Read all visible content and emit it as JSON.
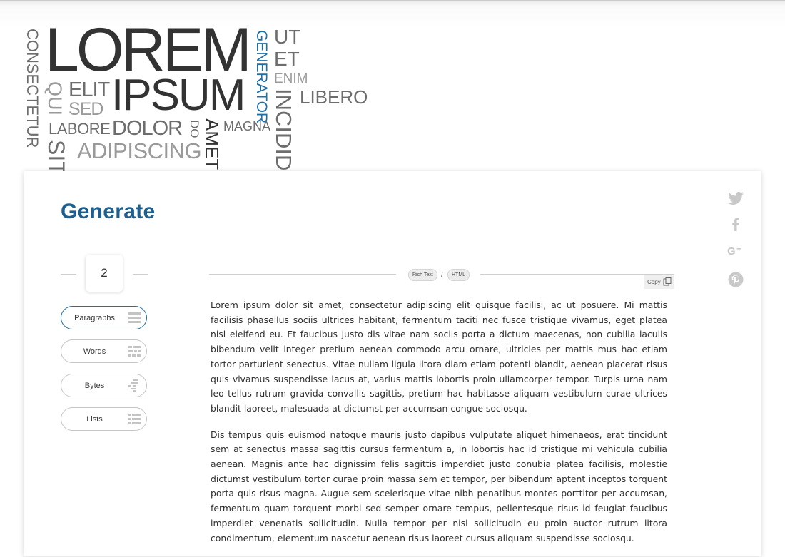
{
  "word_cloud": {
    "consectetur": "CONSECTETUR",
    "lorem": "LOREM",
    "ipsum": "IPSUM",
    "qui": "QUI",
    "elit": "ELIT",
    "sed": "SED",
    "labore": "LABORE",
    "dolor": "DOLOR",
    "do": "DO",
    "amet": "AMET",
    "sit": "SIT",
    "adipiscing": "ADIPISCING",
    "generator": "GENERATOR",
    "magna": "MAGNA",
    "ut": "UT",
    "et": "ET",
    "enim": "ENIM",
    "libero": "LIBERO",
    "incidid": "INCIDID"
  },
  "generator": {
    "title": "Generate",
    "count": "2",
    "modes": {
      "paragraphs": "Paragraphs",
      "words": "Words",
      "bytes": "Bytes",
      "lists": "Lists"
    },
    "active_mode": "Paragraphs",
    "format_tabs": {
      "rich_text": "Rich Text",
      "separator": "/",
      "html": "HTML"
    },
    "copy_label": "Copy",
    "paragraphs": [
      "Lorem ipsum dolor sit amet, consectetur adipiscing elit quisque facilisi, ac ut posuere. Mi mattis facilisis phasellus sociis ultrices habitant, fermentum taciti nec fusce tristique vivamus, eget platea nisl eleifend eu. Et faucibus justo dis vitae nam sociis porta a dictum maecenas, non cubilia iaculis bibendum velit integer pretium aenean commodo arcu ornare, ultricies per mattis mus hac etiam tortor parturient senectus. Vitae nullam ligula litora diam etiam potenti blandit, aenean placerat risus quis vivamus suspendisse lacus at, varius mattis lobortis proin ullamcorper tempor. Turpis urna nam leo tellus rutrum gravida convallis sagittis, pretium hac habitasse aliquam vestibulum curae ultrices blandit laoreet, malesuada at dictumst per accumsan congue sociosqu.",
      "Dis tempus quis euismod natoque mauris justo dapibus vulputate aliquet himenaeos, erat tincidunt sem at senectus massa sagittis cursus fermentum a, in lobortis hac id tristique mi vehicula cubilia aenean. Magnis ante hac dignissim felis sagittis imperdiet justo conubia platea facilisis, molestie dictumst vestibulum tortor curae proin massa sem et tempor, per bibendum aptent inceptos torquent porta quis risus magna. Augue sem scelerisque vitae nibh penatibus montes porttitor per accumsan, fermentum quam torquent morbi sed semper ornare tempus, pellentesque risus id feugiat faucibus imperdiet venenatis sollicitudin. Nulla tempor per nisi sollicitudin eu proin auctor rutrum litora condimentum, elementum nascetur aenean risus laoreet cursus aliquam suspendisse sociosqu."
    ]
  },
  "social": [
    "twitter-icon",
    "facebook-icon",
    "google-plus-icon",
    "pinterest-icon"
  ],
  "colors": {
    "accent": "#1d6fa5",
    "title": "#1d5f8e",
    "text": "#2e2e2e"
  }
}
